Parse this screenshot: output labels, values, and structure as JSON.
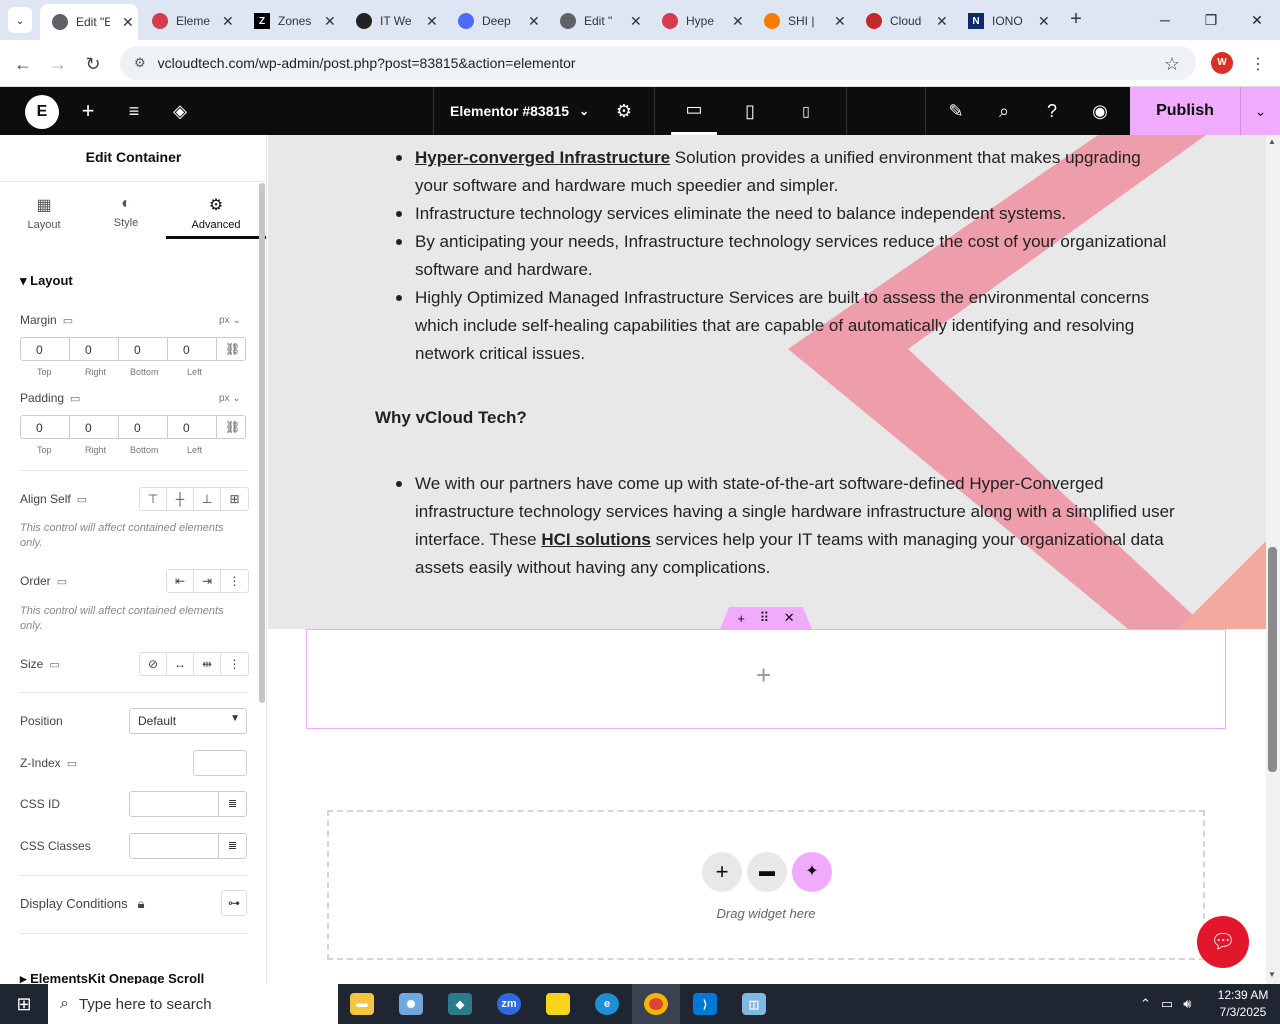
{
  "tabs": [
    {
      "title": "Edit \"E",
      "fav_color": "#5f6368",
      "active": true
    },
    {
      "title": "Eleme",
      "fav_color": "#d63b4f"
    },
    {
      "title": "Zones",
      "fav_color": "#000000"
    },
    {
      "title": "IT We",
      "fav_color": "#222222"
    },
    {
      "title": "Deep",
      "fav_color": "#4a6cf7"
    },
    {
      "title": "Edit \"",
      "fav_color": "#5f6368"
    },
    {
      "title": "Hype",
      "fav_color": "#d63b4f"
    },
    {
      "title": "SHI |",
      "fav_color": "#f57c00"
    },
    {
      "title": "Cloud",
      "fav_color": "#c62828"
    },
    {
      "title": "IONO",
      "fav_color": "#0b2a6b"
    }
  ],
  "address": {
    "url": "vcloudtech.com/wp-admin/post.php?post=83815&action=elementor",
    "profile_letter": "W"
  },
  "editor": {
    "doc_title": "Elementor #83815",
    "publish_label": "Publish",
    "accent": "#f0abfc"
  },
  "panel": {
    "title": "Edit Container",
    "tabs": [
      "Layout",
      "Style",
      "Advanced"
    ],
    "section_layout": "Layout",
    "margin_label": "Margin",
    "padding_label": "Padding",
    "unit": "px",
    "margin": [
      "0",
      "0",
      "0",
      "0"
    ],
    "padding": [
      "0",
      "0",
      "0",
      "0"
    ],
    "sides": [
      "Top",
      "Right",
      "Bottom",
      "Left"
    ],
    "align_self_label": "Align Self",
    "align_note": "This control will affect contained elements only.",
    "order_label": "Order",
    "order_note": "This control will affect contained elements only.",
    "size_label": "Size",
    "position_label": "Position",
    "position_value": "Default",
    "zindex_label": "Z-Index",
    "cssid_label": "CSS ID",
    "cssclasses_label": "CSS Classes",
    "display_conditions_label": "Display Conditions",
    "elementskit_label": "ElementsKit Onepage Scroll"
  },
  "content": {
    "bullets_top": [
      {
        "link": "Hyper-converged Infrastructure",
        "text": " Solution provides a unified environment that makes upgrading your software and hardware much speedier and simpler."
      },
      {
        "link": "",
        "text": "Infrastructure technology services eliminate the need to balance independent systems."
      },
      {
        "link": "",
        "text": "By anticipating your needs, Infrastructure technology services reduce the cost of your organizational software and hardware."
      },
      {
        "link": "",
        "text": "Highly Optimized Managed Infrastructure Services are built to assess the environmental concerns which include self-healing capabilities that are capable of automatically identifying and resolving network critical issues."
      }
    ],
    "heading": "Why vCloud Tech?",
    "bullet2_a": "We with our partners have come up with state-of-the-art software-defined Hyper-Converged infrastructure technology services having a single hardware infrastructure along with a simplified user interface. These ",
    "bullet2_link": "HCI solutions",
    "bullet2_b": " services help your IT teams with managing your organizational data assets easily without having any complications.",
    "drag_label": "Drag widget here"
  },
  "taskbar": {
    "search_placeholder": "Type here to search",
    "time": "12:39 AM",
    "date": "7/3/2025"
  }
}
